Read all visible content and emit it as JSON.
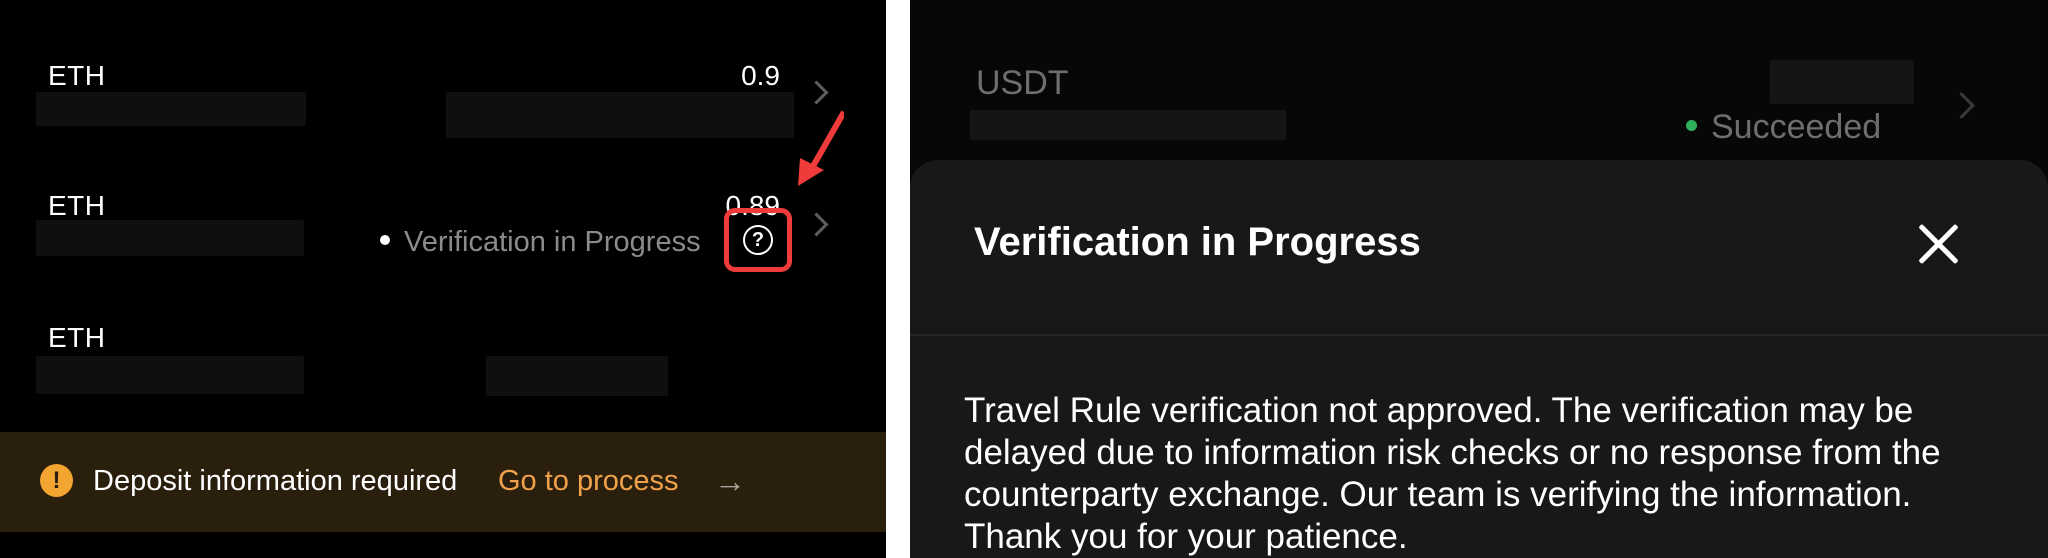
{
  "left_panel": {
    "transactions": [
      {
        "asset": "ETH",
        "amount": "0.9"
      },
      {
        "asset": "ETH",
        "amount": "0.89",
        "status": "Verification in Progress",
        "help_icon": "question-circle-icon"
      },
      {
        "asset": "ETH",
        "amount": ""
      }
    ],
    "banner": {
      "icon": "exclamation-circle-icon",
      "message": "Deposit information required",
      "link": "Go to process",
      "arrow": "→"
    },
    "colors": {
      "highlight": "#f03b3b",
      "link": "#f0a24b",
      "banner_bg": "#2a1e0c"
    }
  },
  "right_panel": {
    "background_row": {
      "asset": "USDT",
      "status": "Succeeded"
    },
    "sheet": {
      "title": "Verification in Progress",
      "close_icon": "close-icon",
      "body": "Travel Rule verification not approved. The verification may be delayed due to information risk checks or no response from the counterparty exchange. Our team is verifying the information. Thank you for your patience."
    },
    "colors": {
      "status_success": "#2faf5a",
      "sheet_bg": "#181818"
    }
  }
}
